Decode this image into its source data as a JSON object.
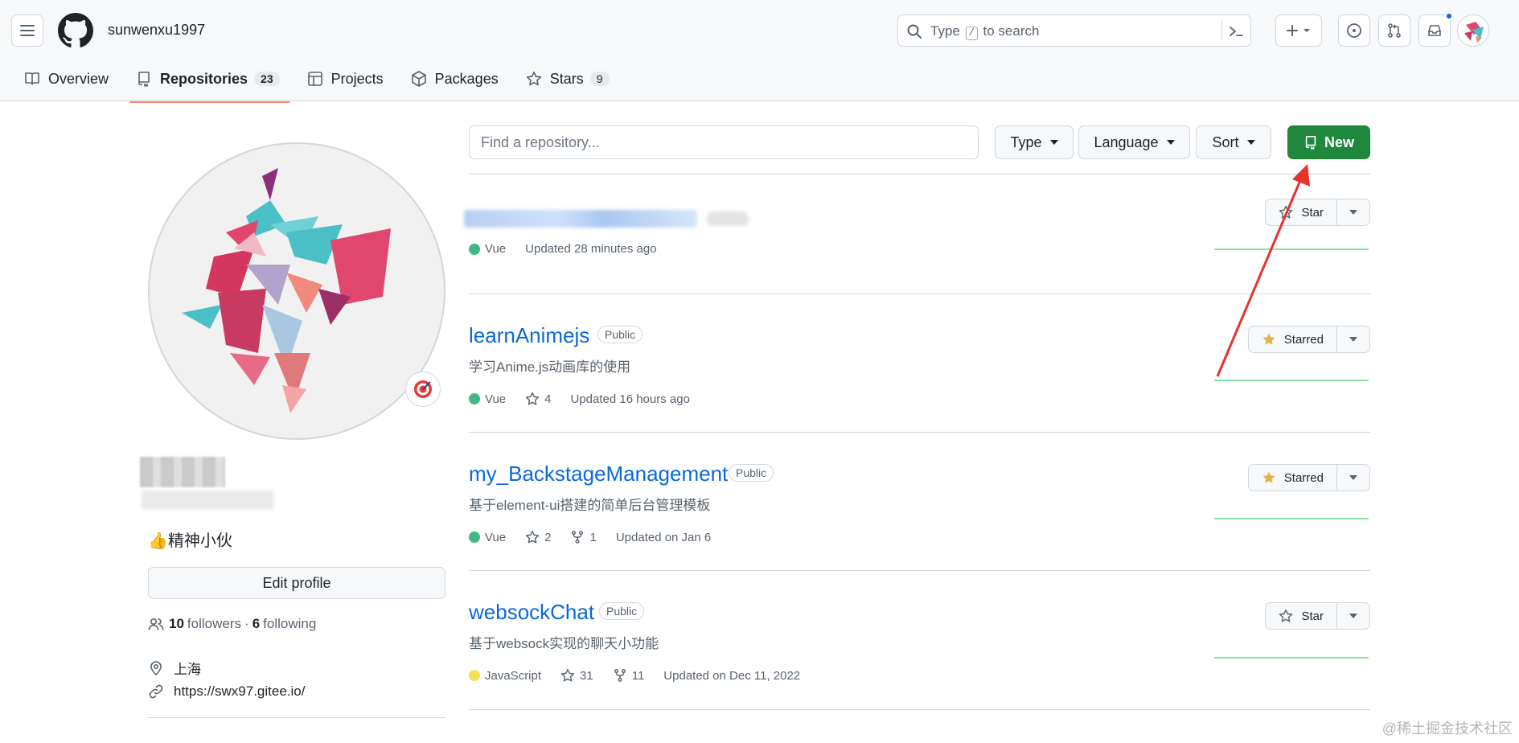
{
  "header": {
    "username": "sunwenxu1997",
    "search": {
      "prefix": "Type",
      "key": "/",
      "suffix": "to search"
    }
  },
  "tabs": [
    {
      "label": "Overview",
      "icon": "book-icon"
    },
    {
      "label": "Repositories",
      "count": "23",
      "icon": "repo-icon"
    },
    {
      "label": "Projects",
      "icon": "table-icon"
    },
    {
      "label": "Packages",
      "icon": "package-icon"
    },
    {
      "label": "Stars",
      "count": "9",
      "icon": "star-icon"
    }
  ],
  "profile": {
    "bio": "👍精神小伙",
    "edit_label": "Edit profile",
    "followers_count": "10",
    "followers_label": "followers",
    "separator": "·",
    "following_count": "6",
    "following_label": "following",
    "location": "上海",
    "website": "https://swx97.gitee.io/"
  },
  "filters": {
    "find_placeholder": "Find a repository...",
    "type_label": "Type",
    "language_label": "Language",
    "sort_label": "Sort",
    "new_label": "New"
  },
  "repos": [
    {
      "language": "Vue",
      "lang_color": "#41b883",
      "updated": "Updated 28 minutes ago",
      "star_label": "Star"
    },
    {
      "name": "learnAnimejs",
      "visibility": "Public",
      "description": "学习Anime.js动画库的使用",
      "language": "Vue",
      "lang_color": "#41b883",
      "stars": "4",
      "updated": "Updated 16 hours ago",
      "star_label": "Starred"
    },
    {
      "name": "my_BackstageManagement",
      "visibility": "Public",
      "description": "基于element-ui搭建的简单后台管理模板",
      "language": "Vue",
      "lang_color": "#41b883",
      "stars": "2",
      "forks": "1",
      "updated": "Updated on Jan 6",
      "star_label": "Starred"
    },
    {
      "name": "websockChat",
      "visibility": "Public",
      "description": "基于websock实现的聊天小功能",
      "language": "JavaScript",
      "lang_color": "#f1e05a",
      "stars": "31",
      "forks": "11",
      "updated": "Updated on Dec 11, 2022",
      "star_label": "Star"
    }
  ],
  "watermark": "@稀土掘金技术社区",
  "colors": {
    "primary_button": "#1f883d",
    "link": "#0969da",
    "tab_underline": "#fd8c73",
    "annotation_arrow": "#e8322c"
  }
}
